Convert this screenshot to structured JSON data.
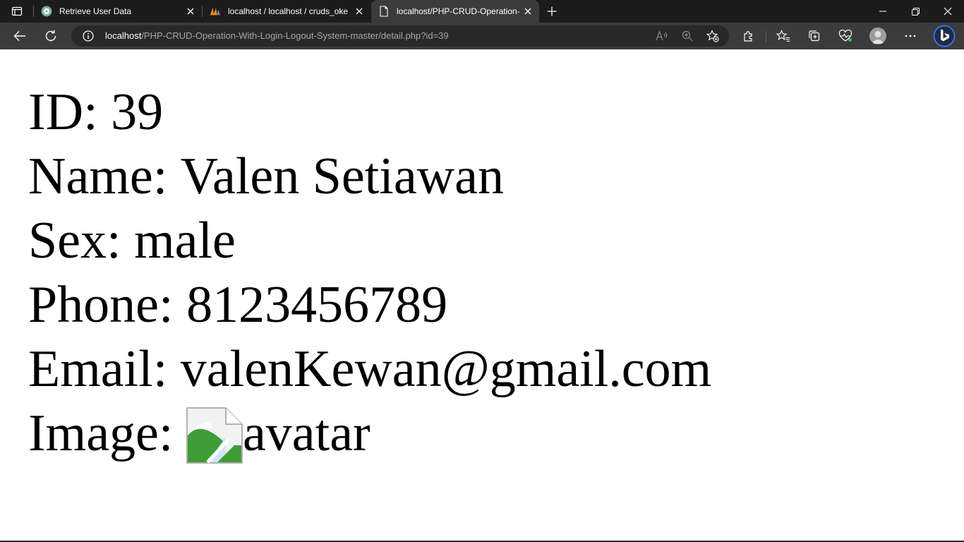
{
  "tabs": [
    {
      "title": "Retrieve User Data",
      "favicon": "openai-icon",
      "active": false
    },
    {
      "title": "localhost / localhost / cruds_oke",
      "favicon": "phpmyadmin-icon",
      "active": false
    },
    {
      "title": "localhost/PHP-CRUD-Operation-",
      "favicon": "page-icon",
      "active": true
    }
  ],
  "address": {
    "host": "localhost",
    "path": "/PHP-CRUD-Operation-With-Login-Logout-System-master/detail.php?id=39"
  },
  "detail": {
    "id_label": "ID: ",
    "id_value": "39",
    "name_label": "Name: ",
    "name_value": "Valen Setiawan",
    "sex_label": "Sex: ",
    "sex_value": "male",
    "phone_label": "Phone: ",
    "phone_value": "8123456789",
    "email_label": "Email: ",
    "email_value": "valenKewan@gmail.com",
    "image_label": "Image: ",
    "image_alt": "avatar"
  },
  "theme": {
    "tabstrip_bg": "#1c1c1c",
    "toolbar_bg": "#3b3b3b",
    "address_bg": "#282828",
    "copilot_blue": "#2f7bf5"
  }
}
